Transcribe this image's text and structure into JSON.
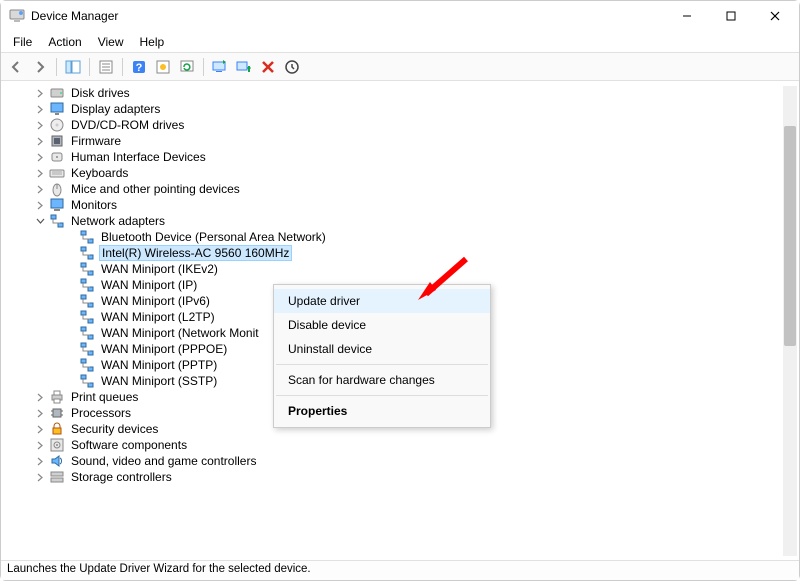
{
  "window": {
    "title": "Device Manager"
  },
  "menu": {
    "file": "File",
    "action": "Action",
    "view": "View",
    "help": "Help"
  },
  "toolbar_icons": {
    "back": "back-arrow-icon",
    "forward": "forward-arrow-icon",
    "show_hide": "show-hide-tree-icon",
    "properties": "properties-icon",
    "help": "help-icon",
    "action1": "action-icon",
    "refresh": "refresh-icon",
    "monitor": "monitor-icon",
    "monitor_green": "monitor-green-icon",
    "delete": "delete-icon",
    "scan": "scan-icon"
  },
  "tree": {
    "items": [
      {
        "label": "Disk drives",
        "icon": "disk-icon",
        "level": 1,
        "expanded": false
      },
      {
        "label": "Display adapters",
        "icon": "display-icon",
        "level": 1,
        "expanded": false
      },
      {
        "label": "DVD/CD-ROM drives",
        "icon": "dvd-icon",
        "level": 1,
        "expanded": false
      },
      {
        "label": "Firmware",
        "icon": "firmware-icon",
        "level": 1,
        "expanded": false
      },
      {
        "label": "Human Interface Devices",
        "icon": "hid-icon",
        "level": 1,
        "expanded": false
      },
      {
        "label": "Keyboards",
        "icon": "keyboard-icon",
        "level": 1,
        "expanded": false
      },
      {
        "label": "Mice and other pointing devices",
        "icon": "mouse-icon",
        "level": 1,
        "expanded": false
      },
      {
        "label": "Monitors",
        "icon": "monitor-icon",
        "level": 1,
        "expanded": false
      },
      {
        "label": "Network adapters",
        "icon": "network-icon",
        "level": 1,
        "expanded": true
      },
      {
        "label": "Bluetooth Device (Personal Area Network)",
        "icon": "net-adapter-icon",
        "level": 2
      },
      {
        "label": "Intel(R) Wireless-AC 9560 160MHz",
        "icon": "net-adapter-icon",
        "level": 2,
        "selected": true
      },
      {
        "label": "WAN Miniport (IKEv2)",
        "icon": "net-adapter-icon",
        "level": 2
      },
      {
        "label": "WAN Miniport (IP)",
        "icon": "net-adapter-icon",
        "level": 2
      },
      {
        "label": "WAN Miniport (IPv6)",
        "icon": "net-adapter-icon",
        "level": 2
      },
      {
        "label": "WAN Miniport (L2TP)",
        "icon": "net-adapter-icon",
        "level": 2
      },
      {
        "label": "WAN Miniport (Network Monit",
        "icon": "net-adapter-icon",
        "level": 2
      },
      {
        "label": "WAN Miniport (PPPOE)",
        "icon": "net-adapter-icon",
        "level": 2
      },
      {
        "label": "WAN Miniport (PPTP)",
        "icon": "net-adapter-icon",
        "level": 2
      },
      {
        "label": "WAN Miniport (SSTP)",
        "icon": "net-adapter-icon",
        "level": 2
      },
      {
        "label": "Print queues",
        "icon": "printer-icon",
        "level": 1,
        "expanded": false
      },
      {
        "label": "Processors",
        "icon": "processor-icon",
        "level": 1,
        "expanded": false
      },
      {
        "label": "Security devices",
        "icon": "security-icon",
        "level": 1,
        "expanded": false
      },
      {
        "label": "Software components",
        "icon": "software-icon",
        "level": 1,
        "expanded": false
      },
      {
        "label": "Sound, video and game controllers",
        "icon": "sound-icon",
        "level": 1,
        "expanded": false
      },
      {
        "label": "Storage controllers",
        "icon": "storage-icon",
        "level": 1,
        "expanded": false
      }
    ]
  },
  "context_menu": {
    "update_driver": "Update driver",
    "disable_device": "Disable device",
    "uninstall_device": "Uninstall device",
    "scan_hw": "Scan for hardware changes",
    "properties": "Properties"
  },
  "statusbar": {
    "text": "Launches the Update Driver Wizard for the selected device."
  }
}
